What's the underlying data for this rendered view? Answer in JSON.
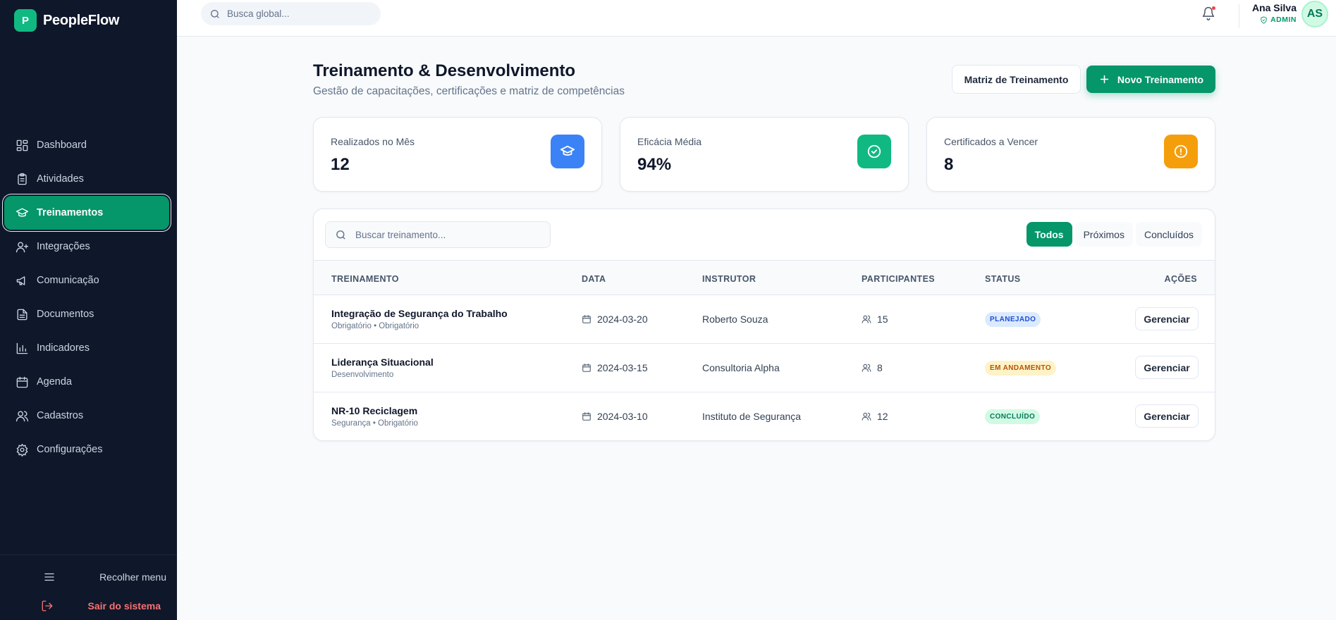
{
  "app": {
    "logo_letter": "P",
    "name": "PeopleFlow"
  },
  "sidebar": {
    "items": [
      {
        "label": "Dashboard",
        "icon": "dashboard-icon"
      },
      {
        "label": "Atividades",
        "icon": "clipboard-icon"
      },
      {
        "label": "Treinamentos",
        "icon": "graduation-cap-icon",
        "active": true
      },
      {
        "label": "Integrações",
        "icon": "user-plus-icon"
      },
      {
        "label": "Comunicação",
        "icon": "megaphone-icon"
      },
      {
        "label": "Documentos",
        "icon": "file-icon"
      },
      {
        "label": "Indicadores",
        "icon": "bar-chart-icon"
      },
      {
        "label": "Agenda",
        "icon": "calendar-icon"
      },
      {
        "label": "Cadastros",
        "icon": "users-icon"
      },
      {
        "label": "Configurações",
        "icon": "gear-icon"
      }
    ],
    "collapse_label": "Recolher menu",
    "logout_label": "Sair do sistema"
  },
  "topbar": {
    "search_placeholder": "Busca global...",
    "user_name": "Ana Silva",
    "user_role": "ADMIN",
    "user_initials": "AS"
  },
  "header": {
    "title": "Treinamento & Desenvolvimento",
    "subtitle": "Gestão de capacitações, certificações e matriz de competências",
    "matrix_button": "Matriz de Treinamento",
    "new_button": "Novo Treinamento"
  },
  "stats": [
    {
      "label": "Realizados no Mês",
      "value": "12",
      "color": "#3b82f6",
      "icon": "graduation-cap-icon"
    },
    {
      "label": "Eficácia Média",
      "value": "94%",
      "color": "#10b981",
      "icon": "check-circle-icon"
    },
    {
      "label": "Certificados a Vencer",
      "value": "8",
      "color": "#f59e0b",
      "icon": "alert-circle-icon"
    }
  ],
  "table": {
    "search_placeholder": "Buscar treinamento...",
    "filters": [
      "Todos",
      "Próximos",
      "Concluídos"
    ],
    "active_filter": "Todos",
    "headers": [
      "TREINAMENTO",
      "DATA",
      "INSTRUTOR",
      "PARTICIPANTES",
      "STATUS",
      "AÇÕES"
    ],
    "rows": [
      {
        "name": "Integração de Segurança do Trabalho",
        "category": "Obrigatório • Obrigatório",
        "date": "2024-03-20",
        "instructor": "Roberto Souza",
        "participants": "15",
        "status": "PLANEJADO",
        "status_bg": "#dbeafe",
        "status_fg": "#1d4ed8",
        "action": "Gerenciar"
      },
      {
        "name": "Liderança Situacional",
        "category": "Desenvolvimento",
        "date": "2024-03-15",
        "instructor": "Consultoria Alpha",
        "participants": "8",
        "status": "EM ANDAMENTO",
        "status_bg": "#fef3c7",
        "status_fg": "#b45309",
        "action": "Gerenciar"
      },
      {
        "name": "NR-10 Reciclagem",
        "category": "Segurança • Obrigatório",
        "date": "2024-03-10",
        "instructor": "Instituto de Segurança",
        "participants": "12",
        "status": "CONCLUÍDO",
        "status_bg": "#d1fae5",
        "status_fg": "#047857",
        "action": "Gerenciar"
      }
    ]
  },
  "colors": {
    "sidebar_bg": "#0f172a",
    "accent": "#059669",
    "danger": "#f87171"
  }
}
